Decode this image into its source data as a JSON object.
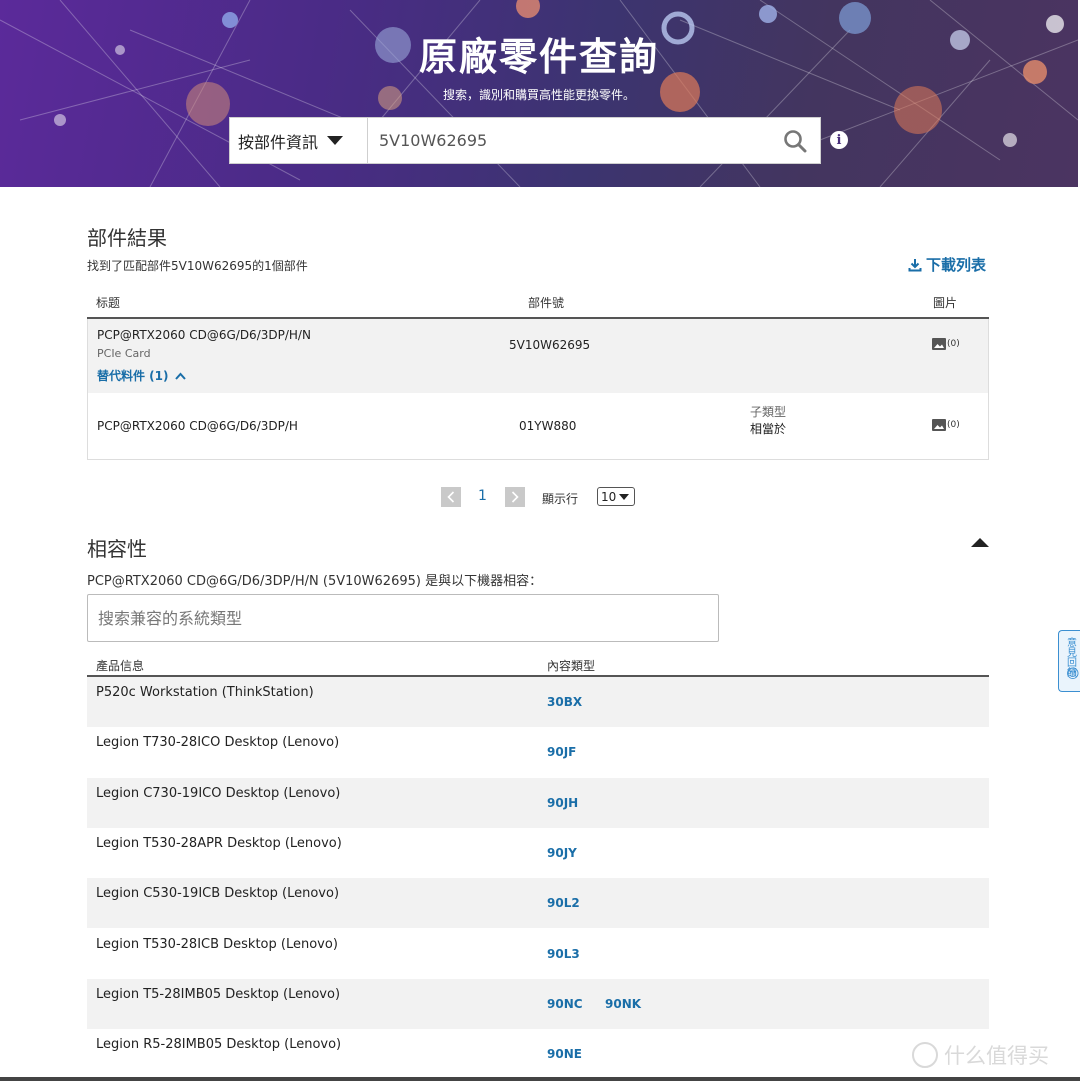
{
  "hero": {
    "title": "原廠零件查詢",
    "subtitle": "搜索，識別和購買高性能更換零件。",
    "search_type": "按部件資訊",
    "search_value": "5V10W62695",
    "info_glyph": "i"
  },
  "results": {
    "heading": "部件結果",
    "summary": "找到了匹配部件5V10W62695的1個部件",
    "download_label": "下載列表",
    "columns": {
      "title": "标题",
      "part_no": "部件號",
      "image": "圖片"
    },
    "main_part": {
      "title": "PCP@RTX2060 CD@6G/D6/3DP/H/N",
      "category": "PCIe Card",
      "part_no": "5V10W62695",
      "image_count": "(0)",
      "alt_link": "替代料件 (1)"
    },
    "alt_part": {
      "title": "PCP@RTX2060 CD@6G/D6/3DP/H",
      "part_no": "01YW880",
      "subtype_label": "子類型",
      "subtype_value": "相當於",
      "image_count": "(0)"
    }
  },
  "pagination": {
    "current_page": "1",
    "rows_label": "顯示行",
    "rows_value": "10"
  },
  "compat": {
    "heading": "相容性",
    "description": "PCP@RTX2060 CD@6G/D6/3DP/H/N (5V10W62695) 是與以下機器相容：",
    "search_placeholder": "搜索兼容的系統類型",
    "columns": {
      "product": "產品信息",
      "content_type": "內容類型"
    },
    "rows": [
      {
        "name": "P520c Workstation (ThinkStation)",
        "codes": [
          "30BX"
        ]
      },
      {
        "name": "Legion T730-28ICO Desktop (Lenovo)",
        "codes": [
          "90JF"
        ]
      },
      {
        "name": "Legion C730-19ICO Desktop (Lenovo)",
        "codes": [
          "90JH"
        ]
      },
      {
        "name": "Legion T530-28APR Desktop (Lenovo)",
        "codes": [
          "90JY"
        ]
      },
      {
        "name": "Legion C530-19ICB Desktop (Lenovo)",
        "codes": [
          "90L2"
        ]
      },
      {
        "name": "Legion T530-28ICB Desktop (Lenovo)",
        "codes": [
          "90L3"
        ]
      },
      {
        "name": "Legion T5-28IMB05 Desktop (Lenovo)",
        "codes": [
          "90NC",
          "90NK"
        ]
      },
      {
        "name": "Legion R5-28IMB05 Desktop (Lenovo)",
        "codes": [
          "90NE"
        ]
      }
    ]
  },
  "feedback": {
    "label": "意見回饋"
  },
  "watermark": {
    "text": "什么值得买"
  },
  "colors": {
    "link": "#1a6ea8",
    "hero_start": "#5b2a9a",
    "hero_end": "#4b3461"
  }
}
